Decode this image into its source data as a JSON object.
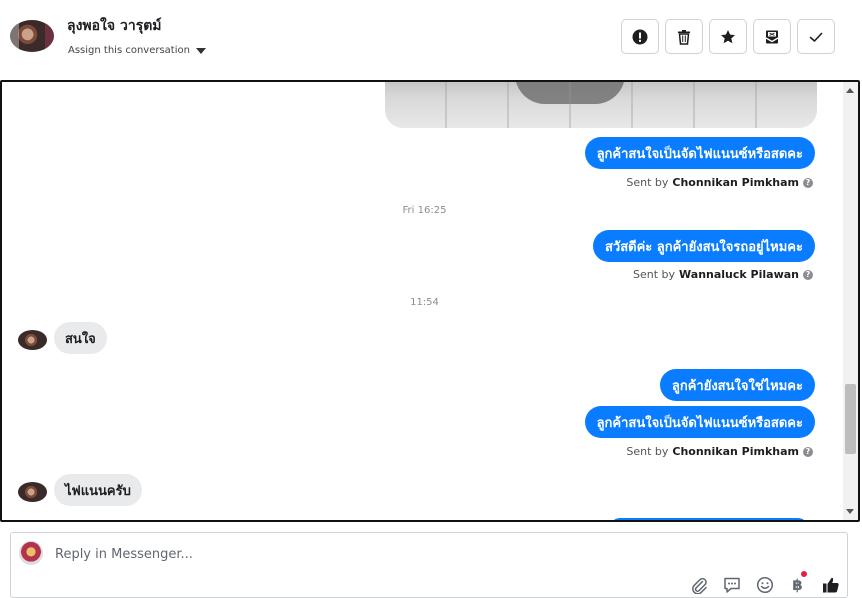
{
  "header": {
    "contact_name": "ลุงพอใจ วารุตม์",
    "assign_label": "Assign this conversation"
  },
  "toolbar": {
    "buttons": [
      "spam-icon",
      "trash-icon",
      "star-icon",
      "archive-icon",
      "check-icon"
    ]
  },
  "thread": {
    "messages": [
      {
        "type": "image",
        "direction": "outgoing"
      },
      {
        "type": "text",
        "direction": "outgoing",
        "text": "ลูกค้าสนใจเป็นจัดไฟแนนซ์หรือสดคะ"
      },
      {
        "type": "sent_by",
        "prefix": "Sent by",
        "agent": "Chonnikan Pimkham"
      },
      {
        "type": "timestamp",
        "text": "Fri 16:25"
      },
      {
        "type": "text",
        "direction": "outgoing",
        "text": "สวัสดีค่ะ  ลูกค้ายังสนใจรถอยู่ไหมคะ"
      },
      {
        "type": "sent_by",
        "prefix": "Sent by",
        "agent": "Wannaluck Pilawan"
      },
      {
        "type": "timestamp",
        "text": "11:54"
      },
      {
        "type": "text",
        "direction": "incoming",
        "text": "สนใจ"
      },
      {
        "type": "text",
        "direction": "outgoing",
        "text": "ลูกค้ายังสนใจใช่ไหมคะ"
      },
      {
        "type": "text",
        "direction": "outgoing",
        "text": "ลูกค้าสนใจเป็นจัดไฟแนนซ์หรือสดคะ"
      },
      {
        "type": "sent_by",
        "prefix": "Sent by",
        "agent": "Chonnikan Pimkham"
      },
      {
        "type": "text",
        "direction": "incoming",
        "text": "ไฟแนนครับ"
      }
    ]
  },
  "composer": {
    "placeholder": "Reply in Messenger...",
    "icons": [
      "attachment-icon",
      "saved-replies-icon",
      "emoji-icon",
      "payment-icon",
      "like-icon"
    ],
    "payment_symbol": "฿"
  },
  "colors": {
    "outgoing_bubble": "#0a7cff",
    "incoming_bubble": "#e9eaec",
    "notification_dot": "#e41e3f"
  }
}
